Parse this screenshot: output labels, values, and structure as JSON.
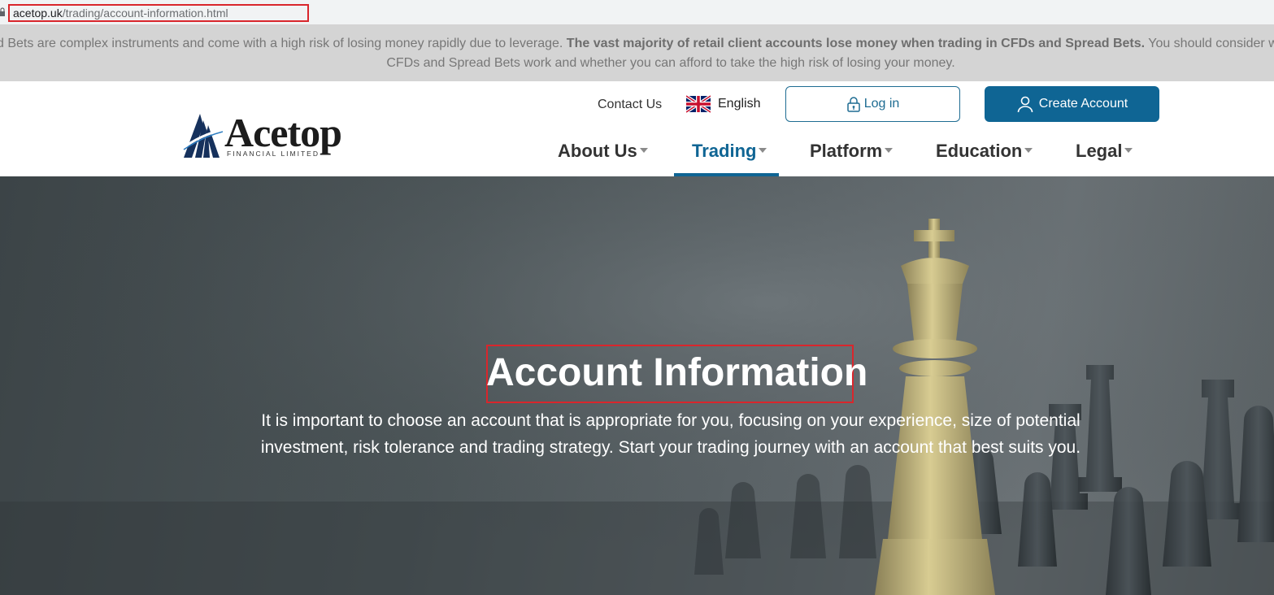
{
  "address_bar": {
    "domain": "acetop.uk",
    "path": "/trading/account-information.html"
  },
  "risk_warning": {
    "line1_start": "d Bets are complex instruments and come with a high risk of losing money rapidly due to leverage. ",
    "line1_bold": "The vast majority of retail client accounts lose money when trading in CFDs and Spread Bets.",
    "line1_end": " You should consider w",
    "line2": "CFDs and Spread Bets work and whether you can afford to take the high risk of losing your money."
  },
  "header": {
    "logo": {
      "name": "Acetop",
      "subtitle": "FINANCIAL LIMITED"
    },
    "contact_label": "Contact Us",
    "language_label": "English",
    "login_label": "Log in",
    "create_account_label": "Create Account"
  },
  "nav": {
    "items": [
      {
        "label": "About Us",
        "active": false
      },
      {
        "label": "Trading",
        "active": true
      },
      {
        "label": "Platform",
        "active": false
      },
      {
        "label": "Education",
        "active": false
      },
      {
        "label": "Legal",
        "active": false
      }
    ]
  },
  "hero": {
    "title": "Account Information",
    "text": "It is important to choose an account that is appropriate for you, focusing on your experience, size of potential investment, risk tolerance and trading strategy. Start your trading journey with an account that best suits you."
  },
  "colors": {
    "brand_blue": "#0f6594",
    "highlight_red": "#d9262c",
    "warning_bg": "#d4d4d4"
  },
  "icons": {
    "address": "lock-icon",
    "language": "uk-flag-icon",
    "login": "padlock-icon",
    "create_account": "user-icon",
    "nav_caret": "caret-down-icon"
  }
}
